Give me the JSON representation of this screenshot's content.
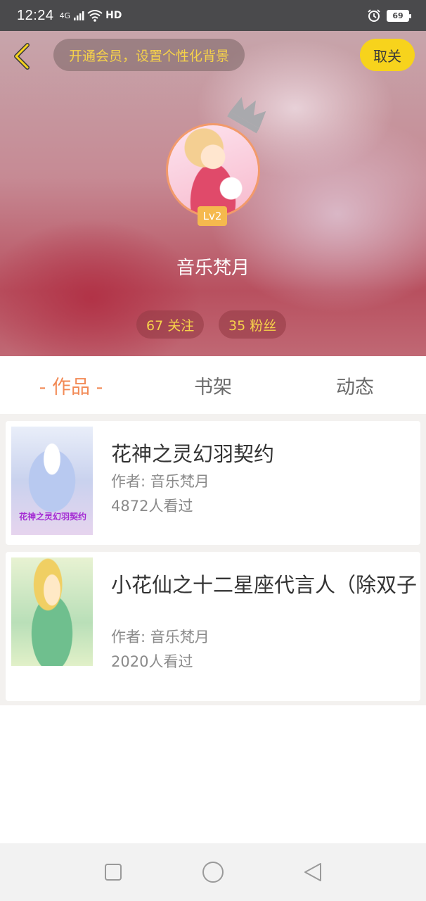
{
  "status_bar": {
    "time": "12:24",
    "network": "4G",
    "hd": "HD",
    "battery": "69",
    "icons": [
      "signal-icon",
      "wifi-icon",
      "hd-icon",
      "alarm-icon",
      "battery-icon"
    ]
  },
  "header": {
    "vip_banner": "开通会员，设置个性化背景",
    "follow_button": "取关",
    "level": "Lv2",
    "username": "音乐梵月",
    "following": "67 关注",
    "fans": "35 粉丝"
  },
  "tabs": [
    {
      "label": "- 作品 -",
      "active": true
    },
    {
      "label": "书架",
      "active": false
    },
    {
      "label": "动态",
      "active": false
    }
  ],
  "works": [
    {
      "title": "花神之灵幻羽契约",
      "author": "作者: 音乐梵月",
      "views": "4872人看过",
      "cover_caption": "花神之灵幻羽契约"
    },
    {
      "title": "小花仙之十二星座代言人（除双子",
      "author": "作者: 音乐梵月",
      "views": "2020人看过"
    }
  ],
  "nav_bar": [
    "square-icon",
    "circle-icon",
    "triangle-back-icon"
  ],
  "colors": {
    "accent_orange": "#f28a56",
    "vip_gold": "#f6d24a",
    "follow_yellow": "#f7d31c",
    "level_badge": "#f5b94e"
  }
}
